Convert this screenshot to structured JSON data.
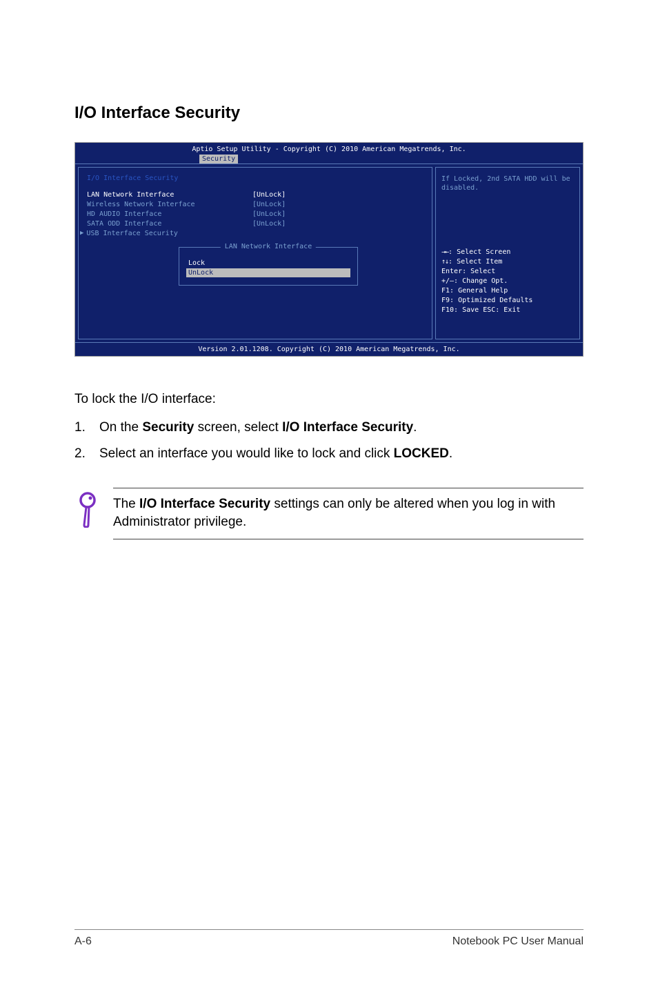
{
  "section_title": "I/O Interface Security",
  "bios": {
    "header": "Aptio Setup Utility - Copyright (C) 2010 American Megatrends, Inc.",
    "tab": "Security",
    "panel_heading": "I/O Interface Security",
    "items": {
      "lan_label": "LAN Network Interface",
      "lan_val": "[UnLock]",
      "wireless_label": "Wireless Network Interface",
      "wireless_val": "[UnLock]",
      "hdaudio_label": "HD AUDIO Interface",
      "hdaudio_val": "[UnLock]",
      "sata_label": "SATA ODD Interface",
      "sata_val": "[UnLock]",
      "usb_label": "USB Interface Security"
    },
    "popup": {
      "title": "LAN Network Interface",
      "opt_lock": "Lock",
      "opt_unlock": "UnLock"
    },
    "help_desc": "If Locked, 2nd SATA HDD will be disabled.",
    "keys": {
      "select_screen": "Select Screen",
      "select_item": "Select Item",
      "enter_select": "Enter: Select",
      "change_opt": "+/—:  Change Opt.",
      "f1": "F1:    General Help",
      "f9": "F9:    Optimized Defaults",
      "f10": "F10:  Save    ESC: Exit"
    },
    "footer": "Version 2.01.1208. Copyright (C) 2010 American Megatrends, Inc."
  },
  "instructions": {
    "lead": "To lock the I/O interface:",
    "step1_num": "1.",
    "step1_a": "On the ",
    "step1_b": "Security",
    "step1_c": " screen, select ",
    "step1_d": "I/O Interface Security",
    "step1_e": ".",
    "step2_num": "2.",
    "step2_a": "Select an interface you would like to lock and click ",
    "step2_b": "LOCKED",
    "step2_c": "."
  },
  "note": {
    "a": "The ",
    "b": "I/O Interface Security",
    "c": " settings can only be altered when you log in with Administrator privilege."
  },
  "footer": {
    "left": "A-6",
    "right": "Notebook PC User Manual"
  }
}
